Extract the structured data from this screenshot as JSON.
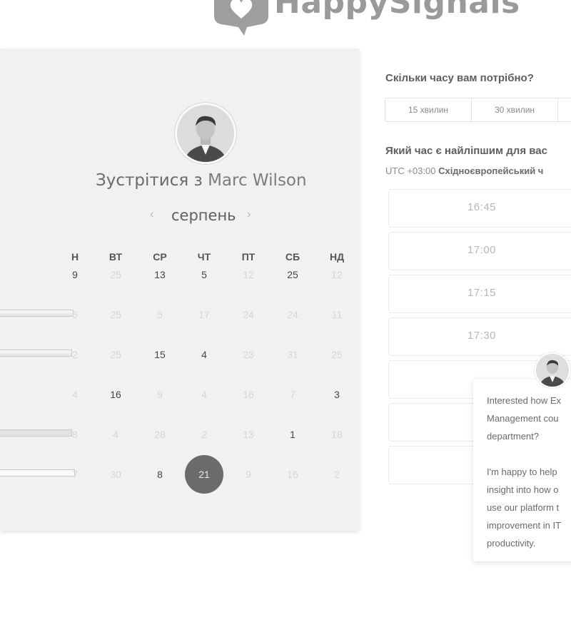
{
  "brand": {
    "logo_text": "HappySignals"
  },
  "host": {
    "meet_prefix": "Зустрітися з ",
    "name": "Marc Wilson"
  },
  "calendar": {
    "month": "серпень",
    "prev_icon": "‹",
    "next_icon": "›",
    "weekdays": [
      "Н",
      "ВТ",
      "СР",
      "ЧТ",
      "ПТ",
      "СБ",
      "НД"
    ],
    "rows": [
      [
        {
          "d": "9",
          "s": "on"
        },
        {
          "d": "25",
          "s": "dim"
        },
        {
          "d": "13",
          "s": "on"
        },
        {
          "d": "5",
          "s": "on"
        },
        {
          "d": "12",
          "s": "dim"
        },
        {
          "d": "25",
          "s": "on"
        },
        {
          "d": "12",
          "s": "dim"
        }
      ],
      [
        {
          "d": "5",
          "s": "dim"
        },
        {
          "d": "25",
          "s": "dim"
        },
        {
          "d": "5",
          "s": "dim"
        },
        {
          "d": "17",
          "s": "dim"
        },
        {
          "d": "24",
          "s": "dim"
        },
        {
          "d": "24",
          "s": "dim"
        },
        {
          "d": "11",
          "s": "dim"
        }
      ],
      [
        {
          "d": "2",
          "s": "dim"
        },
        {
          "d": "25",
          "s": "dim"
        },
        {
          "d": "15",
          "s": "on"
        },
        {
          "d": "4",
          "s": "on"
        },
        {
          "d": "23",
          "s": "dim"
        },
        {
          "d": "31",
          "s": "dim"
        },
        {
          "d": "25",
          "s": "dim"
        }
      ],
      [
        {
          "d": "4",
          "s": "dim"
        },
        {
          "d": "16",
          "s": "on"
        },
        {
          "d": "9",
          "s": "dim"
        },
        {
          "d": "4",
          "s": "dim"
        },
        {
          "d": "16",
          "s": "dim"
        },
        {
          "d": "7",
          "s": "dim"
        },
        {
          "d": "3",
          "s": "on"
        }
      ],
      [
        {
          "d": "8",
          "s": "dim"
        },
        {
          "d": "4",
          "s": "dim"
        },
        {
          "d": "28",
          "s": "dim"
        },
        {
          "d": "2",
          "s": "dim"
        },
        {
          "d": "13",
          "s": "dim"
        },
        {
          "d": "1",
          "s": "on"
        },
        {
          "d": "18",
          "s": "dim"
        }
      ],
      [
        {
          "d": "7",
          "s": "dim"
        },
        {
          "d": "30",
          "s": "dim"
        },
        {
          "d": "8",
          "s": "on"
        },
        {
          "d": "21",
          "s": "sel"
        },
        {
          "d": "9",
          "s": "dim"
        },
        {
          "d": "16",
          "s": "dim"
        },
        {
          "d": "2",
          "s": "dim"
        }
      ]
    ]
  },
  "duration": {
    "question": "Скільки часу вам потрібно?",
    "options": [
      "15 хвилин",
      "30 хвилин"
    ]
  },
  "time_select": {
    "question": "Який час є найліпшим для вас",
    "timezone_offset": "UTC +03:00",
    "timezone_name": "Східноєвропейський ч",
    "slots": [
      "16:45",
      "17:00",
      "17:15",
      "17:30",
      "",
      "",
      ""
    ]
  },
  "chat": {
    "message": "Interested how Ex\nManagement cou\ndepartment?\n\nI'm happy to help\ninsight into how o\nuse our platform t\nimprovement in IT\nproductivity."
  },
  "colors": {
    "panel_bg": "#f1f1f1",
    "selected_day": "#6b6b6b",
    "logo": "#9a9a9a"
  }
}
